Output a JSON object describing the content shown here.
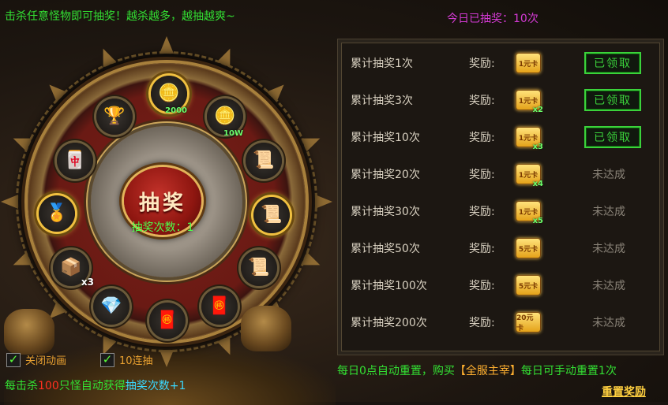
{
  "header": {
    "tip": "击杀任意怪物即可抽奖！越杀越多，越抽越爽~",
    "today_label": "今日已抽奖：",
    "today_count": "10次"
  },
  "wheel": {
    "draw_button_label": "抽奖",
    "draw_count_label": "抽奖次数：",
    "draw_count_value": "1",
    "slots": [
      {
        "icon": "gold-ingot-icon",
        "qty": "2000"
      },
      {
        "icon": "gold-ingot-icon",
        "qty": "10W"
      },
      {
        "icon": "scroll-icon",
        "qty": ""
      },
      {
        "icon": "scroll-icon",
        "qty": ""
      },
      {
        "icon": "scroll-purple-icon",
        "qty": ""
      },
      {
        "icon": "red-envelope-icon",
        "qty": ""
      },
      {
        "icon": "red-envelope-icon",
        "qty": ""
      },
      {
        "icon": "silver-ore-icon",
        "qty": ""
      },
      {
        "icon": "book-icon",
        "qty": "x3"
      },
      {
        "icon": "gold-badge-icon",
        "qty": ""
      },
      {
        "icon": "token-icon",
        "qty": ""
      },
      {
        "icon": "treasure-icon",
        "qty": ""
      }
    ]
  },
  "options": {
    "disable_animation": "关闭动画",
    "ten_draws": "10连抽"
  },
  "bottom_tip": {
    "part1": "每击杀",
    "kills": "100",
    "part2": "只怪自动获得",
    "part3": "抽奖次数+1"
  },
  "rewards": {
    "reward_label": "奖励:",
    "claimed_label": "已领取",
    "not_done_label": "未达成",
    "rows": [
      {
        "label": "累计抽奖1次",
        "card": "1元卡",
        "multiplier": "",
        "status": "claimed"
      },
      {
        "label": "累计抽奖3次",
        "card": "1元卡",
        "multiplier": "x2",
        "status": "claimed"
      },
      {
        "label": "累计抽奖10次",
        "card": "1元卡",
        "multiplier": "x3",
        "status": "claimed"
      },
      {
        "label": "累计抽奖20次",
        "card": "1元卡",
        "multiplier": "x4",
        "status": "todo"
      },
      {
        "label": "累计抽奖30次",
        "card": "1元卡",
        "multiplier": "x5",
        "status": "todo"
      },
      {
        "label": "累计抽奖50次",
        "card": "5元卡",
        "multiplier": "",
        "status": "todo"
      },
      {
        "label": "累计抽奖100次",
        "card": "5元卡",
        "multiplier": "",
        "status": "todo"
      },
      {
        "label": "累计抽奖200次",
        "card": "20元卡",
        "multiplier": "",
        "status": "todo"
      }
    ]
  },
  "footer": {
    "reset_tip_part1": "每日0点自动重置，购买",
    "reset_tip_highlight": "【全服主宰】",
    "reset_tip_part2": "每日可手动重置1次",
    "reset_button": "重置奖励"
  }
}
